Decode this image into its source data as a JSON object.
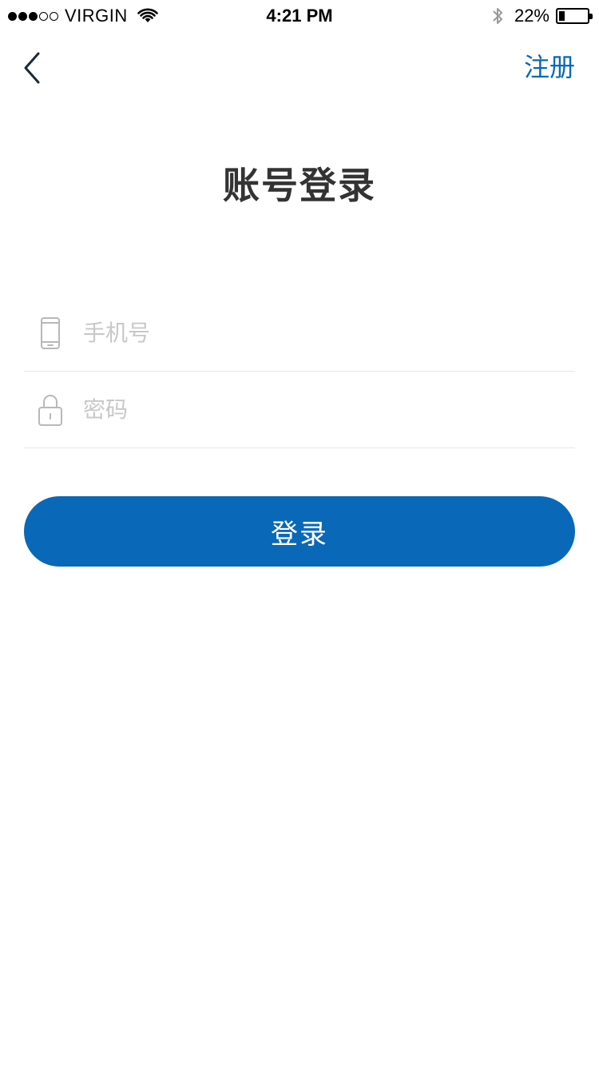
{
  "status_bar": {
    "carrier": "VIRGIN",
    "time": "4:21 PM",
    "battery_percent": "22%",
    "battery_level": 0.22,
    "signal_full": 3,
    "signal_total": 5,
    "icons": [
      "wifi-icon",
      "bluetooth-icon",
      "battery-icon"
    ]
  },
  "nav": {
    "back_icon": "chevron-left-icon",
    "register_label": "注册"
  },
  "page": {
    "title": "账号登录"
  },
  "form": {
    "phone": {
      "icon": "phone-icon",
      "placeholder": "手机号",
      "value": ""
    },
    "password": {
      "icon": "lock-icon",
      "placeholder": "密码",
      "value": ""
    },
    "submit_label": "登录"
  },
  "colors": {
    "accent": "#0a68b8",
    "title": "#333333",
    "placeholder": "#c8c8c8",
    "divider": "#e6e6e6"
  }
}
